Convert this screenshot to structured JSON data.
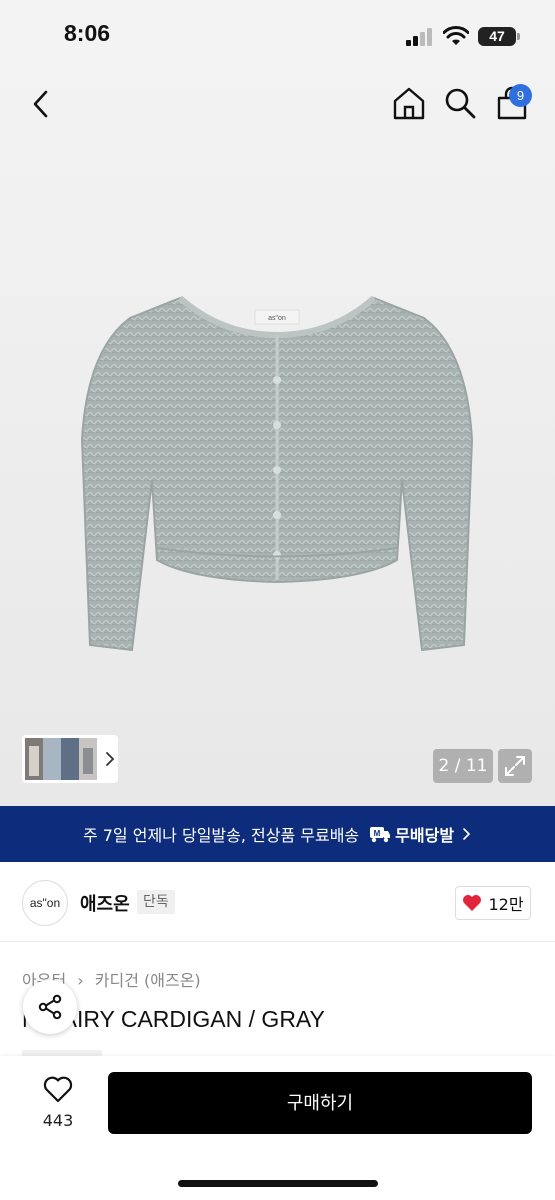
{
  "status_bar": {
    "time": "8:06",
    "battery": "47"
  },
  "header": {
    "cart_count": "9",
    "icons": [
      "back-icon",
      "home-icon",
      "search-icon",
      "cart-icon"
    ]
  },
  "gallery": {
    "page_counter": "2 / 11",
    "brand_label_on_garment": "as\"on"
  },
  "banner": {
    "text": "주 7일 언제나 당일발송, 전상품 무료배송",
    "service_name": "무배당발"
  },
  "brand": {
    "logo_text": "as\"on",
    "name": "애즈온",
    "tag": "단독",
    "likes": "12만",
    "like_color": "#e0263a"
  },
  "product": {
    "category": [
      "아우터",
      "카디건 (애즈온)"
    ],
    "title": "N HAIRY CARDIGAN / GRAY"
  },
  "actions": {
    "wish_count": "443",
    "buy_label": "구매하기"
  },
  "colors": {
    "banner_bg": "#0d2d7c",
    "badge": "#2f6fe0",
    "buy_bg": "#000000"
  }
}
